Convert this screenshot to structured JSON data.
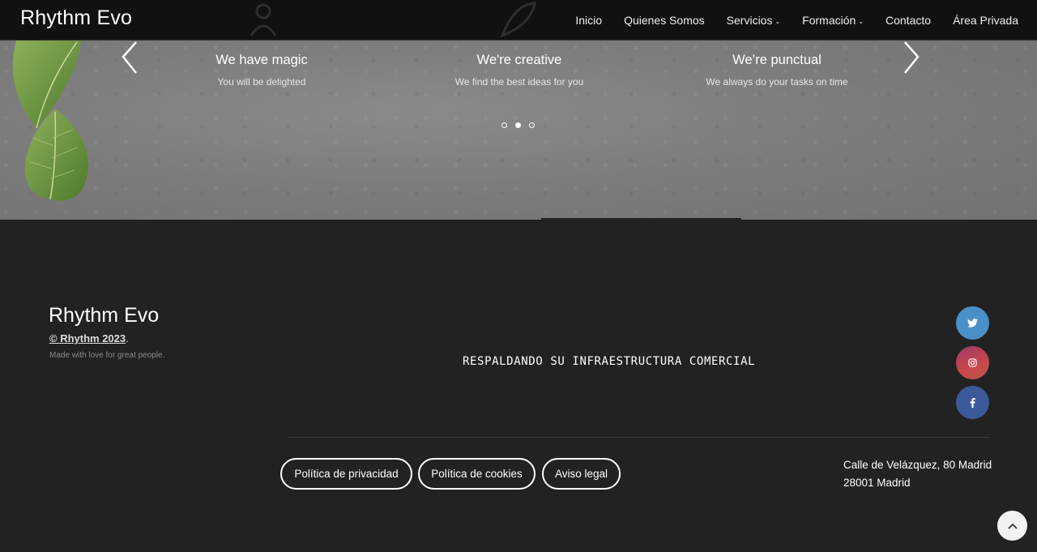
{
  "navbar": {
    "brand": "Rhythm Evo",
    "items": [
      {
        "label": "Inicio",
        "dropdown": false
      },
      {
        "label": "Quienes Somos",
        "dropdown": false
      },
      {
        "label": "Servicios",
        "dropdown": true
      },
      {
        "label": "Formación",
        "dropdown": true
      },
      {
        "label": "Contacto",
        "dropdown": false
      },
      {
        "label": "Área Privada",
        "dropdown": false
      }
    ]
  },
  "slider": {
    "slides": [
      {
        "title": "We have magic",
        "subtitle": "You will be delighted"
      },
      {
        "title": "We're creative",
        "subtitle": "We find the best ideas for you"
      },
      {
        "title": "We’re punctual",
        "subtitle": "We always do your tasks on time"
      }
    ],
    "active_dot": 2,
    "dot_count": 3
  },
  "footer": {
    "brand": "Rhythm Evo",
    "copyright_link": "© Rhythm 2023",
    "copyright_suffix": ".",
    "made_with": "Made with love for great people.",
    "tagline": "RESPALDANDO SU INFRAESTRUCTURA COMERCIAL",
    "social": [
      {
        "name": "twitter",
        "icon": "twitter-icon",
        "color": "#4a90c8"
      },
      {
        "name": "instagram",
        "icon": "instagram-icon",
        "color": "#c9474b"
      },
      {
        "name": "facebook",
        "icon": "facebook-icon",
        "color": "#3c5a99"
      }
    ],
    "links": [
      "Política de privacidad",
      "Política de cookies",
      "Aviso legal"
    ],
    "address_line1": "Calle de Velázquez, 80 Madrid",
    "address_line2": "28001 Madrid"
  },
  "colors": {
    "navbar_bg": "#111111",
    "footer_bg": "#222222",
    "hero_bg": "#7d7d7d"
  }
}
